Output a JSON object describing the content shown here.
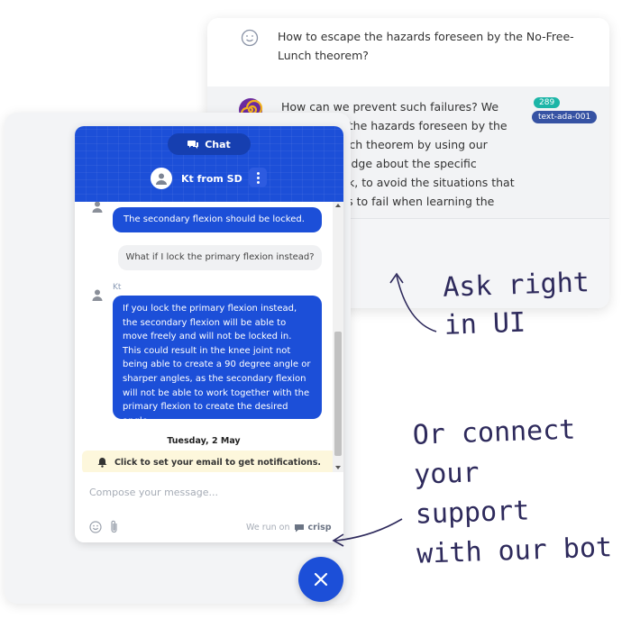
{
  "qa": {
    "question": "How to escape the hazards foreseen by the No-Free-Lunch theorem?",
    "answer": "How can we prevent such failures? We can escape the hazards foreseen by the No-Free-Lunch theorem by using our prior knowledge about the specific learning task, to avoid the situations that will cause us to fail when learning the task.",
    "token_count": "289",
    "model": "text-ada-001"
  },
  "chat": {
    "tab_label": "Chat",
    "agent_name": "Kt from SD",
    "messages": {
      "m1": "The secondary flexion should be locked.",
      "m2": "What if I lock the primary flexion instead?",
      "sender": "Kt",
      "m3": "If you lock the primary flexion instead, the secondary flexion will be able to move freely and will not be locked in. This could result in the knee joint not being able to create a 90 degree angle or sharper angles, as the secondary flexion will not be able to work together with the primary flexion to create the desired angle."
    },
    "date": "Tuesday, 2 May",
    "notification": "Click to set your email to get notifications.",
    "compose_placeholder": "Compose your message...",
    "powered_prefix": "We run on",
    "powered_brand": "crisp"
  },
  "annotations": {
    "ask_line1": "Ask right",
    "ask_line2": "in UI",
    "connect_line1": "Or connect",
    "connect_line2": "your",
    "connect_line3": "support",
    "connect_line4": "with our bot"
  },
  "colors": {
    "brand_blue": "#1c4fd8",
    "badge_teal": "#1cb5a7",
    "badge_navy": "#3652a3",
    "handwriting": "#2e2a5c"
  }
}
